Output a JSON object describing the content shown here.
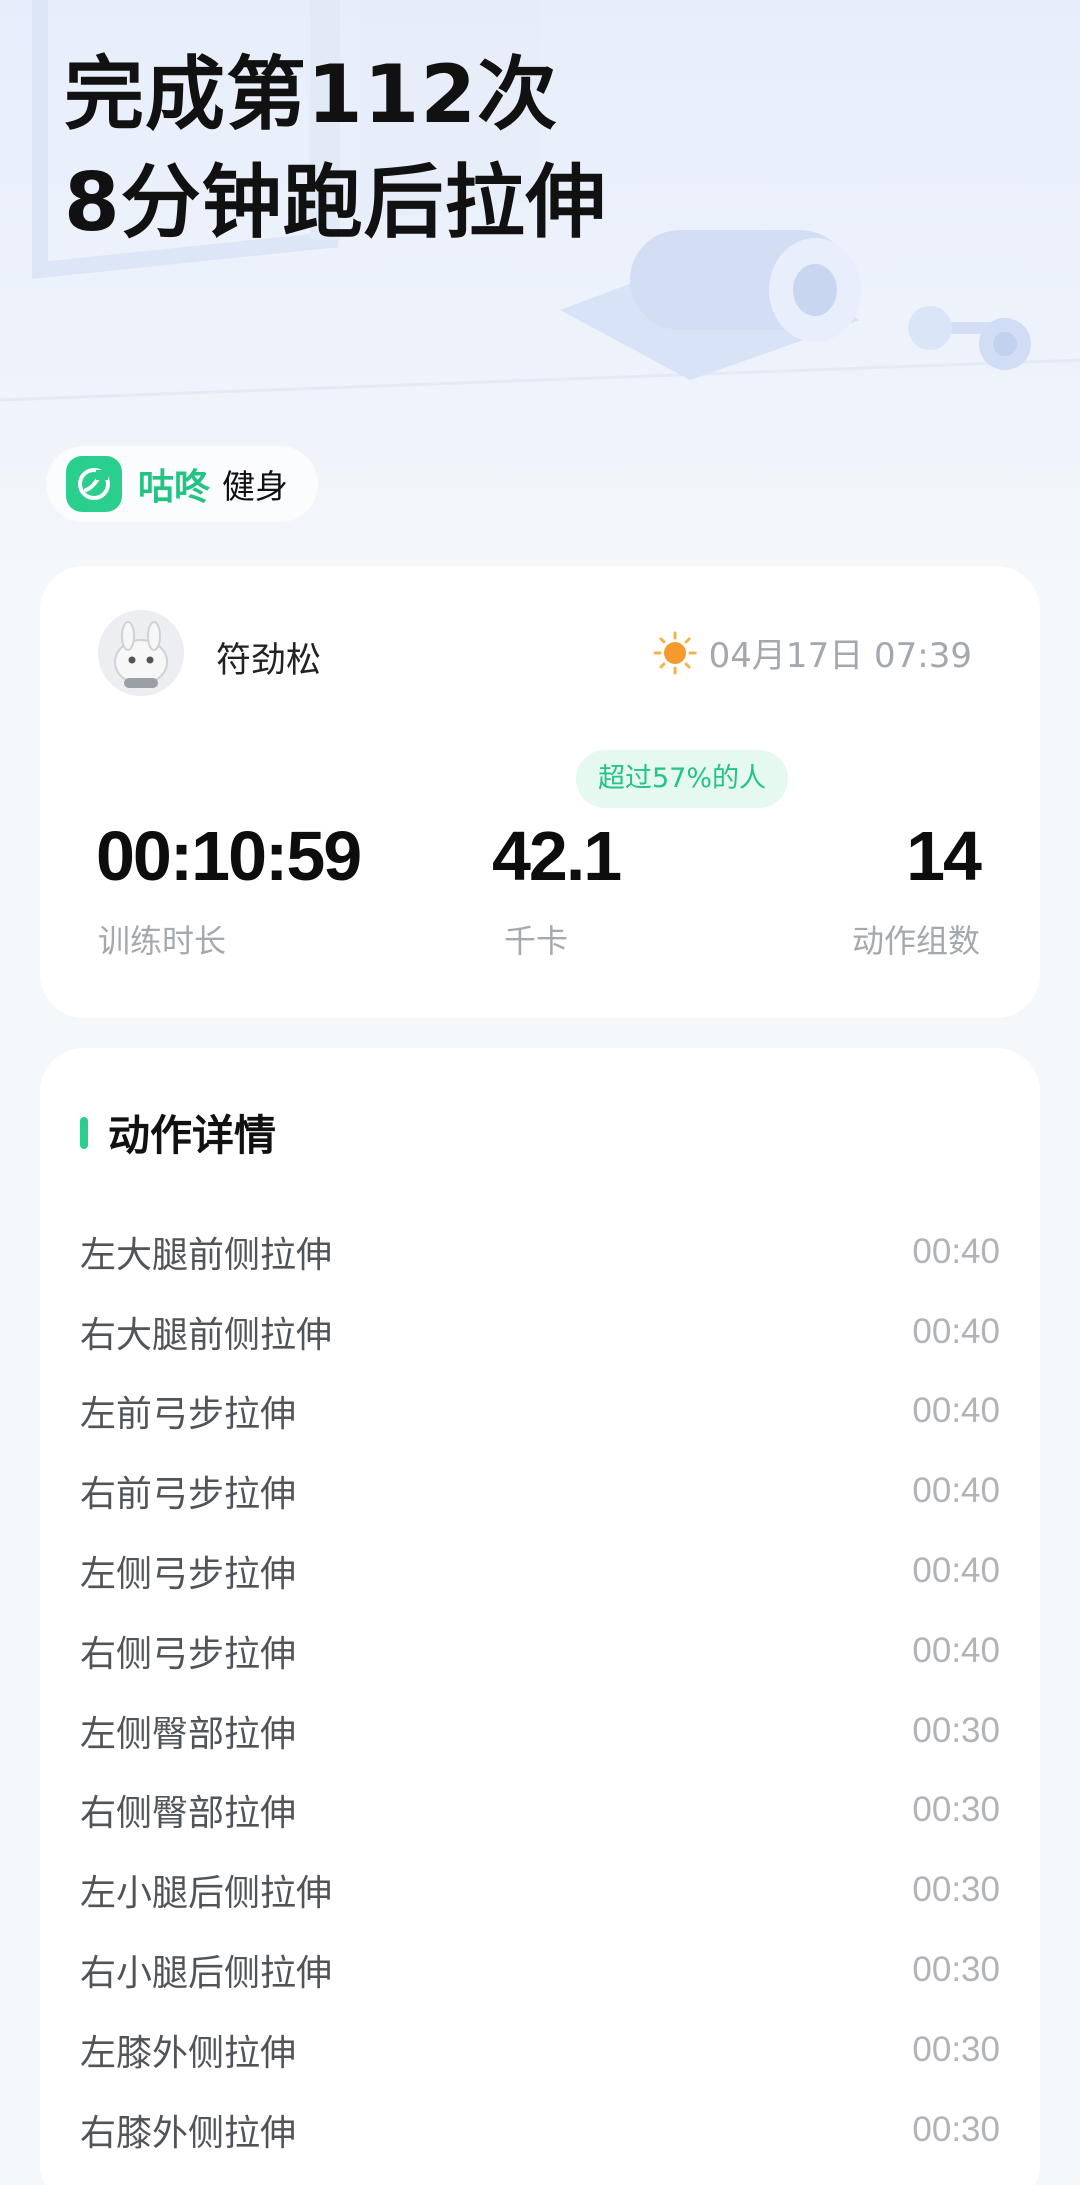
{
  "header": {
    "title_line1": "完成第112次",
    "title_line2": "8分钟跑后拉伸"
  },
  "brand": {
    "name": "咕咚",
    "suffix": "健身",
    "accent_color": "#2bcf8d"
  },
  "summary": {
    "user_name": "符劲松",
    "weather_icon": "sun-icon",
    "datetime": "04月17日 07:39",
    "percentile_badge": "超过57%的人",
    "stats": {
      "duration_value": "00:10:59",
      "duration_label": "训练时长",
      "calories_value": "42.1",
      "calories_label": "千卡",
      "sets_value": "14",
      "sets_label": "动作组数"
    }
  },
  "details": {
    "title": "动作详情",
    "exercises": [
      {
        "name": "左大腿前侧拉伸",
        "time": "00:40"
      },
      {
        "name": "右大腿前侧拉伸",
        "time": "00:40"
      },
      {
        "name": "左前弓步拉伸",
        "time": "00:40"
      },
      {
        "name": "右前弓步拉伸",
        "time": "00:40"
      },
      {
        "name": "左侧弓步拉伸",
        "time": "00:40"
      },
      {
        "name": "右侧弓步拉伸",
        "time": "00:40"
      },
      {
        "name": "左侧臀部拉伸",
        "time": "00:30"
      },
      {
        "name": "右侧臀部拉伸",
        "time": "00:30"
      },
      {
        "name": "左小腿后侧拉伸",
        "time": "00:30"
      },
      {
        "name": "右小腿后侧拉伸",
        "time": "00:30"
      },
      {
        "name": "左膝外侧拉伸",
        "time": "00:30"
      },
      {
        "name": "右膝外侧拉伸",
        "time": "00:30"
      }
    ]
  }
}
